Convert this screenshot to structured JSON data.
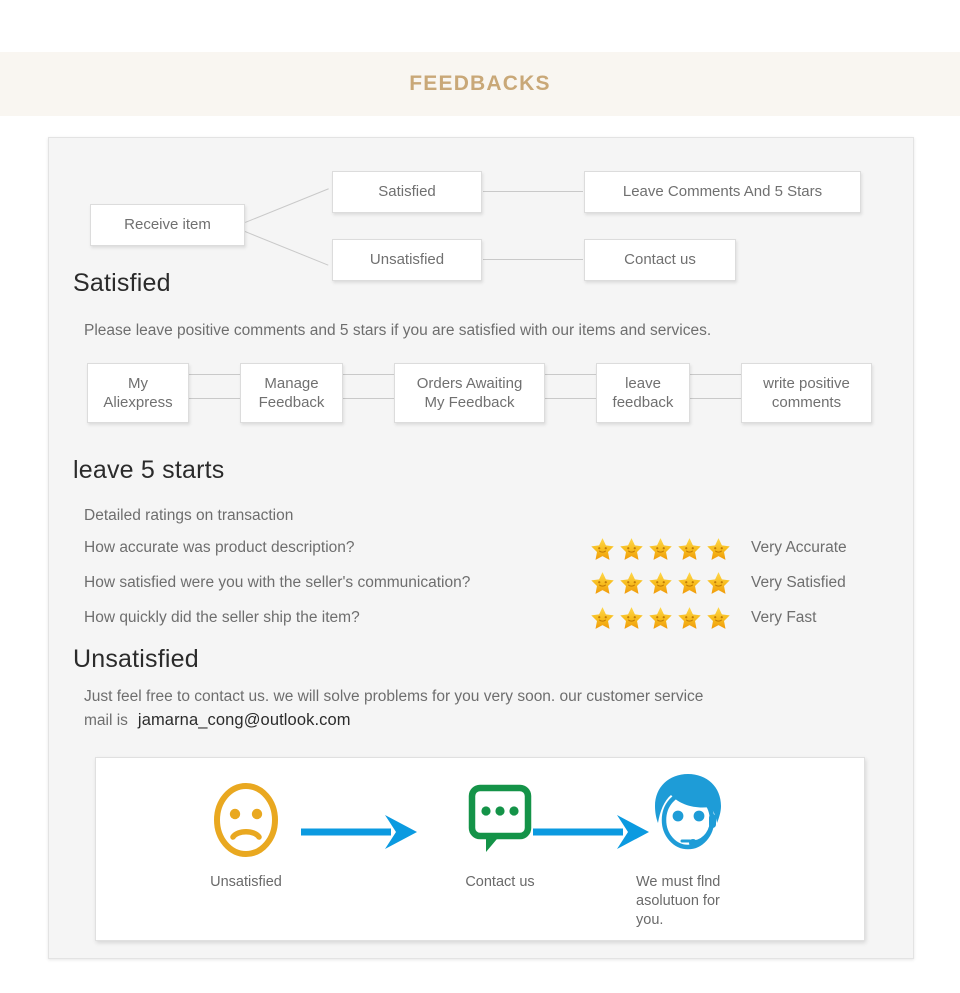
{
  "header": {
    "title": "FEEDBACKS"
  },
  "flow_top": {
    "start": {
      "label": "Receive item"
    },
    "branches": [
      {
        "label": "Satisfied",
        "outcome": "Leave Comments And 5 Stars"
      },
      {
        "label": "Unsatisfied",
        "outcome": "Contact us"
      }
    ]
  },
  "satisfied": {
    "heading": "Satisfied",
    "description": "Please leave positive comments and 5 stars if you are satisfied with our items and services.",
    "steps": [
      {
        "line1": "My",
        "line2": "Aliexpress"
      },
      {
        "line1": "Manage",
        "line2": "Feedback"
      },
      {
        "line1": "Orders Awaiting",
        "line2": "My Feedback"
      },
      {
        "line1": "leave",
        "line2": "feedback"
      },
      {
        "line1": "write positive",
        "line2": "comments"
      }
    ]
  },
  "stars_section": {
    "heading": "leave 5 starts",
    "subheading": "Detailed ratings on transaction",
    "ratings": [
      {
        "question": "How accurate was product description?",
        "stars": 5,
        "value": "Very Accurate"
      },
      {
        "question": "How satisfied were you with the seller's communication?",
        "stars": 5,
        "value": "Very Satisfied"
      },
      {
        "question": "How quickly did the seller ship the item?",
        "stars": 5,
        "value": "Very Fast"
      }
    ]
  },
  "unsatisfied": {
    "heading": "Unsatisfied",
    "description": "Just feel free to contact us. we will solve problems for you very soon. our customer service",
    "mail_prefix": "mail is",
    "email": "jamarna_cong@outlook.com"
  },
  "icon_flow": {
    "steps": [
      {
        "icon": "sad-face-icon",
        "caption": "Unsatisfied"
      },
      {
        "icon": "chat-bubble-icon",
        "caption": "Contact us"
      },
      {
        "icon": "support-agent-icon",
        "caption": "We must flnd\nasolutuon for\nyou."
      }
    ],
    "arrow_icon": "arrow-right-icon"
  },
  "colors": {
    "header_text": "#c9a878",
    "header_band": "#f9f6f1",
    "panel_bg": "#f5f5f5",
    "star_gold": "#f5b324",
    "sad_face": "#e9a820",
    "chat_green": "#149348",
    "agent_blue": "#1e9cd7",
    "arrow_blue": "#0b9ae0",
    "body_text": "#6e6e6e",
    "heading_text": "#2b2b2b"
  }
}
